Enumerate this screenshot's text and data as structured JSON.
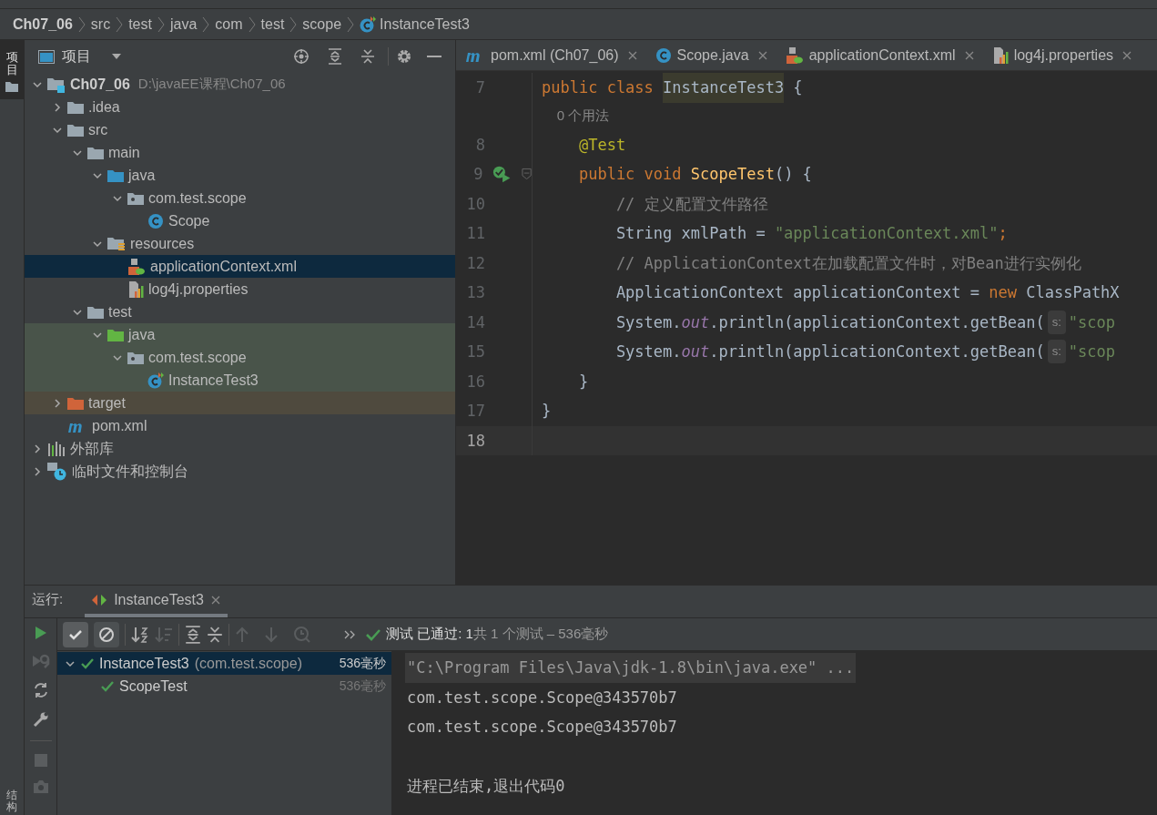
{
  "breadcrumb": [
    {
      "label": "Ch07_06",
      "kind": "root"
    },
    {
      "label": "src",
      "kind": "dir"
    },
    {
      "label": "test",
      "kind": "dir"
    },
    {
      "label": "java",
      "kind": "dir"
    },
    {
      "label": "com",
      "kind": "dir"
    },
    {
      "label": "test",
      "kind": "dir"
    },
    {
      "label": "scope",
      "kind": "dir"
    },
    {
      "label": "InstanceTest3",
      "kind": "test-class"
    }
  ],
  "side_stripe": {
    "top_label": "项目",
    "bottom_label": "结构"
  },
  "project": {
    "title": "项目",
    "tree": [
      {
        "label": "Ch07_06",
        "path": "D:\\javaEE课程\\Ch07_06",
        "kind": "module",
        "expanded": true,
        "selected": false,
        "children": [
          {
            "label": ".idea",
            "kind": "folder",
            "expanded": false,
            "selected": false
          },
          {
            "label": "src",
            "kind": "folder",
            "expanded": true,
            "selected": false,
            "children": [
              {
                "label": "main",
                "kind": "folder",
                "expanded": true,
                "selected": false,
                "children": [
                  {
                    "label": "java",
                    "kind": "source-folder",
                    "expanded": true,
                    "selected": false,
                    "children": [
                      {
                        "label": "com.test.scope",
                        "kind": "package",
                        "expanded": true,
                        "selected": false,
                        "children": [
                          {
                            "label": "Scope",
                            "kind": "class",
                            "selected": false
                          }
                        ]
                      }
                    ]
                  },
                  {
                    "label": "resources",
                    "kind": "resources",
                    "expanded": true,
                    "selected": false,
                    "children": [
                      {
                        "label": "applicationContext.xml",
                        "kind": "xml",
                        "selected": true
                      },
                      {
                        "label": "log4j.properties",
                        "kind": "properties",
                        "selected": false
                      }
                    ]
                  }
                ]
              },
              {
                "label": "test",
                "kind": "folder",
                "expanded": true,
                "selected": false,
                "children": [
                  {
                    "label": "java",
                    "kind": "test-folder",
                    "test_source": true,
                    "expanded": true,
                    "selected": false,
                    "children": [
                      {
                        "label": "com.test.scope",
                        "kind": "package",
                        "test_source": true,
                        "expanded": true,
                        "selected": false,
                        "children": [
                          {
                            "label": "InstanceTest3",
                            "kind": "test-class",
                            "test_source": true,
                            "selected": false
                          }
                        ]
                      }
                    ]
                  }
                ]
              }
            ]
          },
          {
            "label": "target",
            "kind": "excluded-folder",
            "excluded": true,
            "expanded": false,
            "selected": false
          },
          {
            "label": "pom.xml",
            "kind": "maven",
            "selected": false
          }
        ]
      },
      {
        "label": "外部库",
        "kind": "library",
        "expanded": false,
        "selected": false
      },
      {
        "label": "临时文件和控制台",
        "kind": "scratch",
        "expanded": false,
        "selected": false
      }
    ]
  },
  "editor": {
    "tabs": [
      {
        "label": "pom.xml (Ch07_06)",
        "kind": "maven",
        "selected": false
      },
      {
        "label": "Scope.java",
        "kind": "class",
        "selected": false
      },
      {
        "label": "applicationContext.xml",
        "kind": "xml",
        "selected": false
      },
      {
        "label": "log4j.properties",
        "kind": "properties",
        "selected": false
      }
    ],
    "lines": [
      {
        "number": "7",
        "tokens": [
          {
            "text": "public class ",
            "kind": "keyword"
          },
          {
            "text": "InstanceTest3",
            "kind": "highlight"
          },
          {
            "text": " {",
            "kind": "plain"
          }
        ]
      },
      {
        "kind": "usages",
        "tokens": [
          {
            "text": "    0 个用法",
            "kind": "usage"
          }
        ]
      },
      {
        "number": "8",
        "tokens": [
          {
            "text": "    @Test",
            "kind": "annotation"
          }
        ]
      },
      {
        "number": "9",
        "run_marker": true,
        "tokens": [
          {
            "text": "    public void ",
            "kind": "keyword"
          },
          {
            "text": "ScopeTest",
            "kind": "method"
          },
          {
            "text": "() {",
            "kind": "plain"
          }
        ]
      },
      {
        "number": "10",
        "tokens": [
          {
            "text": "        // 定义配置文件路径",
            "kind": "comment"
          }
        ]
      },
      {
        "number": "11",
        "tokens": [
          {
            "text": "        String xmlPath = ",
            "kind": "plain"
          },
          {
            "text": "\"applicationContext.xml\"",
            "kind": "string"
          },
          {
            "text": ";",
            "kind": "keyword"
          }
        ]
      },
      {
        "number": "12",
        "tokens": [
          {
            "text": "        // ApplicationContext在加载配置文件时，对Bean进行实例化",
            "kind": "comment"
          }
        ]
      },
      {
        "number": "13",
        "tokens": [
          {
            "text": "        ApplicationContext applicationContext = ",
            "kind": "plain"
          },
          {
            "text": "new ",
            "kind": "keyword"
          },
          {
            "text": "ClassPathX",
            "kind": "plain"
          }
        ]
      },
      {
        "number": "14",
        "tokens": [
          {
            "text": "        System.",
            "kind": "plain"
          },
          {
            "text": "out",
            "kind": "field"
          },
          {
            "text": ".println(applicationContext.getBean(",
            "kind": "plain"
          },
          {
            "text": "s:",
            "kind": "hint"
          },
          {
            "text": "\"scop",
            "kind": "string"
          }
        ]
      },
      {
        "number": "15",
        "tokens": [
          {
            "text": "        System.",
            "kind": "plain"
          },
          {
            "text": "out",
            "kind": "field"
          },
          {
            "text": ".println(applicationContext.getBean(",
            "kind": "plain"
          },
          {
            "text": "s:",
            "kind": "hint"
          },
          {
            "text": "\"scop",
            "kind": "string"
          }
        ]
      },
      {
        "number": "16",
        "tokens": [
          {
            "text": "    }",
            "kind": "plain"
          }
        ]
      },
      {
        "number": "17",
        "tokens": [
          {
            "text": "}",
            "kind": "plain"
          }
        ]
      },
      {
        "number": "18",
        "current": true
      }
    ]
  },
  "run": {
    "label": "运行:",
    "tab": {
      "label": "InstanceTest3",
      "selected": true
    },
    "status": {
      "passed": "测试 已通过: 1",
      "detail": "共 1 个测试 – 536毫秒"
    },
    "tests": [
      {
        "label": "InstanceTest3",
        "package": "(com.test.scope)",
        "time": "536毫秒",
        "selected": true,
        "expanded": true,
        "children": [
          {
            "label": "ScopeTest",
            "time": "536毫秒",
            "selected": false
          }
        ]
      }
    ],
    "console": [
      {
        "text": "\"C:\\Program Files\\Java\\jdk-1.8\\bin\\java.exe\" ...",
        "kind": "command"
      },
      {
        "text": "com.test.scope.Scope@343570b7",
        "kind": "output"
      },
      {
        "text": "com.test.scope.Scope@343570b7",
        "kind": "output"
      },
      {
        "kind": "blank"
      },
      {
        "text": "进程已结束,退出代码0",
        "kind": "exit"
      }
    ]
  }
}
